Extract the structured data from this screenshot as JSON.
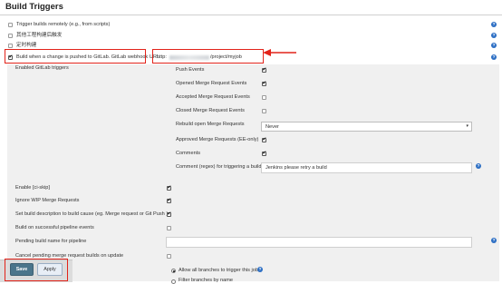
{
  "section": {
    "title": "Build Triggers"
  },
  "triggers": [
    {
      "label": "Trigger builds remotely (e.g., from scripts)",
      "checked": false
    },
    {
      "label": "其他工程构建后触发",
      "checked": false
    },
    {
      "label": "定时构建",
      "checked": false
    },
    {
      "label": "Build when a change is pushed to GitLab. GitLab webhook URL: ",
      "checked": true
    }
  ],
  "webhook": {
    "prefix": "http:",
    "suffix": "/project/myjob"
  },
  "gitlab": {
    "heading": "Enabled GitLab triggers",
    "events": [
      {
        "label": "Push Events",
        "checked": true
      },
      {
        "label": "Opened Merge Request Events",
        "checked": true
      },
      {
        "label": "Accepted Merge Request Events",
        "checked": false
      },
      {
        "label": "Closed Merge Request Events",
        "checked": false
      },
      {
        "label": "Rebuild open Merge Requests",
        "control": "select"
      },
      {
        "label": "Approved Merge Requests (EE-only)",
        "checked": true
      },
      {
        "label": "Comments",
        "checked": true
      },
      {
        "label": "Comment (regex) for triggering a build",
        "control": "input"
      }
    ],
    "rebuild_value": "Never",
    "comment_regex": "Jenkins please retry a build"
  },
  "options": [
    {
      "label": "Enable [ci-skip]",
      "checked": true
    },
    {
      "label": "Ignore WIP Merge Requests",
      "checked": true
    },
    {
      "label": "Set build description to build cause (eg. Merge request or Git Push )",
      "checked": true
    },
    {
      "label": "Build on successful pipeline events",
      "checked": false
    },
    {
      "label": "Pending build name for pipeline",
      "control": "input"
    },
    {
      "label": "Cancel pending merge request builds on update",
      "checked": false
    }
  ],
  "pending_build_name": "",
  "branches": {
    "allow_all": "Allow all branches to trigger this job",
    "filter_by_name": "Filter branches by name"
  },
  "buttons": {
    "save": "Save",
    "apply": "Apply"
  },
  "colors": {
    "accent_red": "#e2231a",
    "help_blue": "#2d6fc4",
    "save_bg": "#4b758b"
  }
}
